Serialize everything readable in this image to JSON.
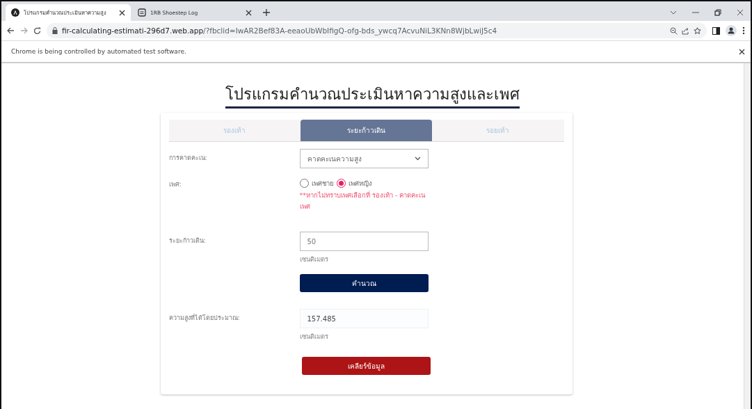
{
  "browser": {
    "tabs": [
      {
        "title": "โปรแกรมคำนวณประเมินหาความสูง",
        "selected": true,
        "kind": "angular"
      },
      {
        "title": "1RB Shoestep Log",
        "selected": false,
        "kind": "log"
      }
    ],
    "url_host": "fir-calculating-estimati-296d7.web.app",
    "url_rest": "/?fbclid=IwAR2Bef83A-eeaoUbWbIfigQ-ofg-bds_ywcq7AcvuNiL3KNn8WjbLwiJ5c4",
    "infobar": "Chrome is being controlled by automated test software."
  },
  "page": {
    "title": "โปรแกรมคำนวณประเมินหาความสูงและเพศ",
    "tabs": [
      {
        "label": "รองเท้า",
        "selected": false
      },
      {
        "label": "ระยะก้าวเดิน",
        "selected": true
      },
      {
        "label": "รอยเท้า",
        "selected": false
      }
    ],
    "prediction": {
      "label": "การคาดคะเน:",
      "value": "คาดคะเนความสูง"
    },
    "gender": {
      "label": "เพศ:",
      "options": [
        {
          "label": "เพศชาย",
          "selected": false
        },
        {
          "label": "เพศหญิง",
          "selected": true
        }
      ],
      "note": "**หากไม่ทราบเพศเลือกที่ รองเท้า - คาดคะเนเพศ"
    },
    "stride": {
      "label": "ระยะก้าวเดิน:",
      "value": "50",
      "unit": "เซนติเมตร"
    },
    "calculate_button": "คำนวณ",
    "result": {
      "label": "ความสูงที่ได้โดยประมาณ:",
      "value": "157.485",
      "unit": "เซนติเมตร"
    },
    "clear_button": "เคลียร์ข้อมูล"
  }
}
